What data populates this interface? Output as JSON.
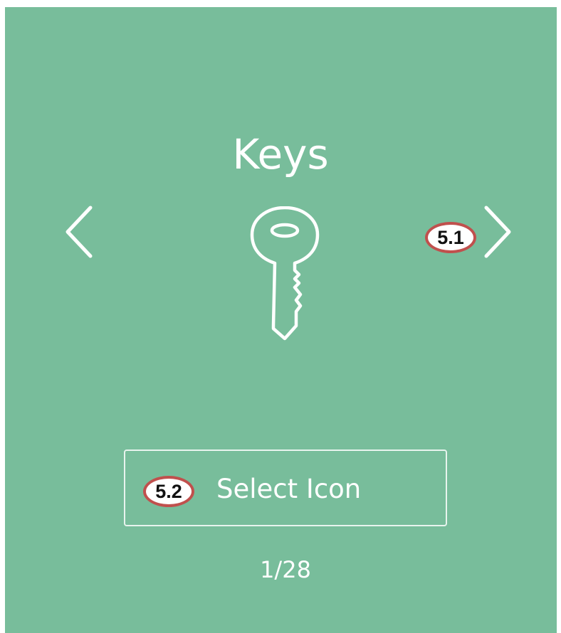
{
  "carousel": {
    "title": "Keys",
    "icon": "key-icon",
    "prev_icon": "chevron-left-icon",
    "next_icon": "chevron-right-icon",
    "select_button_label": "Select Icon",
    "position": "1/28"
  },
  "annotations": {
    "next_callout": "5.1",
    "select_callout": "5.2"
  },
  "colors": {
    "background": "#78bd9b",
    "foreground": "#ffffff",
    "callout_border": "#c0504d"
  }
}
